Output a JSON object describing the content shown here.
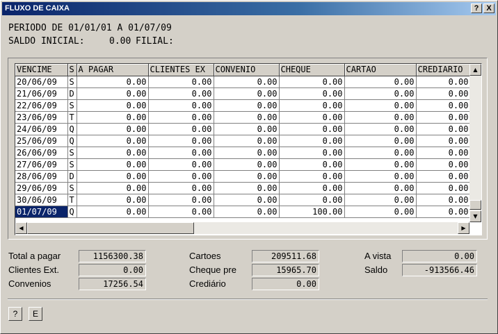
{
  "window": {
    "title": "FLUXO DE CAIXA",
    "help_btn": "?",
    "close_btn": "X"
  },
  "header": {
    "periodo": "PERIODO DE 01/01/01 A 01/07/09",
    "saldo_label": "SALDO INICIAL:",
    "saldo_value": "0.00",
    "filial_label": "FILIAL:"
  },
  "grid": {
    "columns": [
      "VENCIME",
      "S",
      "A PAGAR",
      "CLIENTES EX",
      "CONVENIO",
      "CHEQUE",
      "CARTAO",
      "CREDIARIO"
    ],
    "rows": [
      [
        "20/06/09",
        "S",
        "0.00",
        "0.00",
        "0.00",
        "0.00",
        "0.00",
        "0.00"
      ],
      [
        "21/06/09",
        "D",
        "0.00",
        "0.00",
        "0.00",
        "0.00",
        "0.00",
        "0.00"
      ],
      [
        "22/06/09",
        "S",
        "0.00",
        "0.00",
        "0.00",
        "0.00",
        "0.00",
        "0.00"
      ],
      [
        "23/06/09",
        "T",
        "0.00",
        "0.00",
        "0.00",
        "0.00",
        "0.00",
        "0.00"
      ],
      [
        "24/06/09",
        "Q",
        "0.00",
        "0.00",
        "0.00",
        "0.00",
        "0.00",
        "0.00"
      ],
      [
        "25/06/09",
        "Q",
        "0.00",
        "0.00",
        "0.00",
        "0.00",
        "0.00",
        "0.00"
      ],
      [
        "26/06/09",
        "S",
        "0.00",
        "0.00",
        "0.00",
        "0.00",
        "0.00",
        "0.00"
      ],
      [
        "27/06/09",
        "S",
        "0.00",
        "0.00",
        "0.00",
        "0.00",
        "0.00",
        "0.00"
      ],
      [
        "28/06/09",
        "D",
        "0.00",
        "0.00",
        "0.00",
        "0.00",
        "0.00",
        "0.00"
      ],
      [
        "29/06/09",
        "S",
        "0.00",
        "0.00",
        "0.00",
        "0.00",
        "0.00",
        "0.00"
      ],
      [
        "30/06/09",
        "T",
        "0.00",
        "0.00",
        "0.00",
        "0.00",
        "0.00",
        "0.00"
      ],
      [
        "01/07/09",
        "Q",
        "0.00",
        "0.00",
        "0.00",
        "100.00",
        "0.00",
        "0.00"
      ]
    ],
    "selected_row": 11,
    "scroll_up": "▲",
    "scroll_down": "▼",
    "scroll_left": "◀",
    "scroll_right": "▶"
  },
  "summary": {
    "total_pagar_label": "Total a pagar",
    "total_pagar": "1156300.38",
    "clientes_label": "Clientes Ext.",
    "clientes": "0.00",
    "convenios_label": "Convenios",
    "convenios": "17256.54",
    "cartoes_label": "Cartoes",
    "cartoes": "209511.68",
    "cheque_label": "Cheque pre",
    "cheque": "15965.70",
    "crediario_label": "Crediário",
    "crediario": "0.00",
    "avista_label": "A vista",
    "avista": "0.00",
    "saldo_label": "Saldo",
    "saldo": "-913566.46"
  },
  "buttons": {
    "help": "?",
    "e": "E"
  }
}
